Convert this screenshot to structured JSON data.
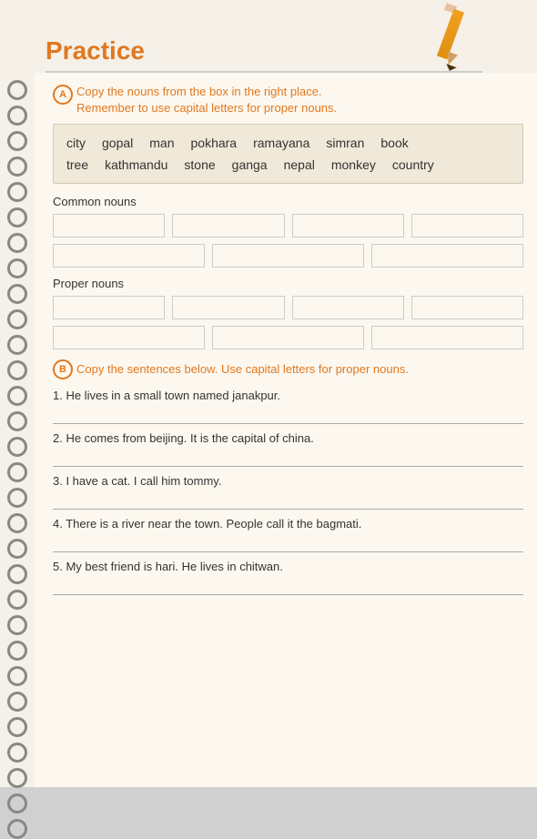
{
  "title": "Practice",
  "pencil": "✏",
  "sectionA": {
    "label": "A",
    "instruction_line1": "Copy the nouns from the box in the right place.",
    "instruction_line2": "Remember to use capital letters for proper nouns.",
    "words_row1": [
      "city",
      "gopal",
      "man",
      "pokhara",
      "ramayana",
      "simran",
      "book"
    ],
    "words_row2": [
      "tree",
      "kathmandu",
      "stone",
      "ganga",
      "nepal",
      "monkey",
      "country"
    ],
    "common_nouns_label": "Common nouns",
    "proper_nouns_label": "Proper nouns"
  },
  "sectionB": {
    "label": "B",
    "instruction": "Copy the sentences below. Use capital letters for proper nouns.",
    "sentences": [
      "1. He lives in a small town named janakpur.",
      "2. He comes from beijing. It is the capital of china.",
      "3. I have a cat. I call him tommy.",
      "4. There is a river near the town. People call it the bagmati.",
      "5. My best friend is hari. He lives in chitwan."
    ]
  }
}
